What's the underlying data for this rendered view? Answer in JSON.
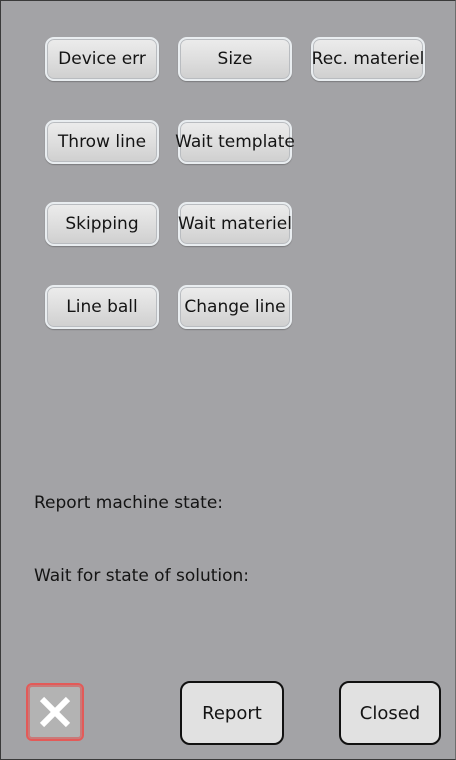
{
  "buttons": {
    "device_err": "Device err",
    "size": "Size",
    "rec_materiel": "Rec. materiel",
    "throw_line": "Throw line",
    "wait_template": "Wait template",
    "skipping": "Skipping",
    "wait_materiel": "Wait materiel",
    "line_ball": "Line ball",
    "change_line": "Change line"
  },
  "labels": {
    "report_machine_state": "Report machine state:",
    "wait_for_state": "Wait for state of solution:"
  },
  "footer": {
    "report": "Report",
    "closed": "Closed",
    "close_icon": "close-x-icon"
  },
  "colors": {
    "background": "#a3a3a6",
    "close_border": "#e35a58"
  }
}
